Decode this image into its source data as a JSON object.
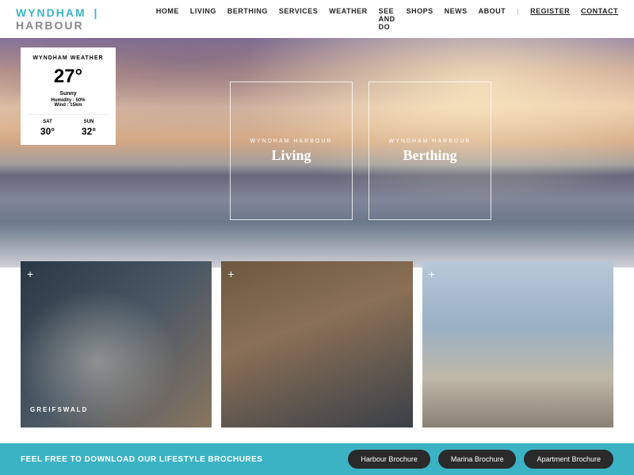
{
  "logo": {
    "first": "WYNDHAM",
    "second": "HARBOUR"
  },
  "nav": {
    "items": [
      "HOME",
      "LIVING",
      "BERTHING",
      "SERVICES",
      "WEATHER",
      "SEE AND DO",
      "SHOPS",
      "NEWS",
      "ABOUT"
    ],
    "register": "REGISTER",
    "contact": "CONTACT"
  },
  "weather": {
    "title": "WYNDHAM WEATHER",
    "temp": "27°",
    "condition": "Sunny",
    "humidity": "Humidity : 50%",
    "wind": "Wind : 15km",
    "forecast": [
      {
        "day": "SAT",
        "temp": "30°"
      },
      {
        "day": "SUN",
        "temp": "32°"
      }
    ]
  },
  "features": [
    {
      "sub": "WYNDHAM HARBOUR",
      "title": "Living"
    },
    {
      "sub": "WYNDHAM HARBOUR",
      "title": "Berthing"
    }
  ],
  "tiles": [
    {
      "caption": "GREIFSWALD"
    },
    {
      "caption": ""
    },
    {
      "caption": ""
    }
  ],
  "footer": {
    "text": "FEEL FREE TO DOWNLOAD OUR LIFESTYLE BROCHURES",
    "buttons": [
      "Harbour Brochure",
      "Marina Brochure",
      "Apartment Brochure"
    ]
  }
}
